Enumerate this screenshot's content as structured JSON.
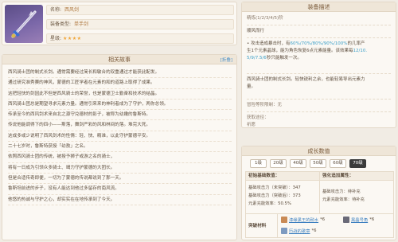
{
  "info": {
    "name_label": "名称:",
    "name_value": "西风剑",
    "type_label": "装备类型:",
    "type_value": "单手剑",
    "stars_label": "星级:",
    "stars": "★★★★"
  },
  "story": {
    "title": "相关故事",
    "fold_link": "[折叠]",
    "lines": [
      "西风骑士团的制式长剑。通常需要经过简长和敏合的双重通过才能获此配发。",
      "通过研究准秀赛的神风，蒙德的工匠学者在元素的和的道路上取得了成果。",
      "这把轻快的剑因此不但是西风骑士的荣誉，也是蒙德卫士勤奋和技术的结晶。",
      "西风骑士团总是期望寻求元素力量。通常引来来的神利者成为了守护，两你总领。",
      "传承至今的西风剑术来自北之源守兑德材的影子，被称为幼嫩的鲁斯特。",
      "传说他能调得下的四小——斯落，舞剑严彩的风和林间的落。堆完大死。",
      "这成多或少说明了西风剑术的性情：轻、快、精准，以此守护蒙德平安。",
      "二十七岁时，鲁斯特获授「幼敖」之名。",
      "依照西风骑士团的传统，被授予狮子或游之名的骑士，",
      "将有一日成为引领众多骑士、竭力守护蒙德的大团长。",
      "但是合适传奇即便，一切为了蒙德的传说都说到了那一天。",
      "鲁斯坦前进的步子，没有人能达到他过多留存的南风流。",
      "他悠的热诚与守护之心，却实实在在地传承到了今天。"
    ]
  },
  "desc": {
    "title": "装备描述",
    "refine_hint": "精炼(1/2/3/4/5)阶",
    "passive_name": "顺风而行",
    "effect_1": "• 攻击造成暴击时，有",
    "effect_1_pct": "60%/70%/80%/90%/100%",
    "effect_1b": "的几率产",
    "effect_2": "生1个元素晶球，能为角色恢复6点元素能量。该效果每",
    "effect_2_cd": "12/10.",
    "effect_3_cd": "5/9/7.5/6",
    "effect_3": "秒只能触发一次。",
    "lore_1": "西风骑士团的制式长剑。轻快锐利之余，也能轻易导出元素力",
    "lore_2": "量。",
    "obtain_limit": "冒险等阶限制：无",
    "obtain_label": "获取途径：",
    "obtain_value": "祈愿"
  },
  "growth": {
    "title": "成长数值",
    "tabs": [
      "1级",
      "20级",
      "40级",
      "50级",
      "60级",
      "70级"
    ],
    "active_tab": "70级",
    "initial_label": "初始基础数值：",
    "boost_label": "强化追加属性：",
    "atk_unrefined": "基础攻击力（未突破）：347",
    "atk_refined": "基础攻击力（突破后）：373",
    "recharge": "元素充能效率：50.5%",
    "boost_atk": "基础攻击力：待补充",
    "boost_recharge": "元素充能效率：待补充",
    "materials_label": "突破材料",
    "mat1_name": "漆缘黑王的耐水",
    "mat1_count": "*6",
    "mat2_name": "黑晶号角",
    "mat2_count": "*6",
    "mat3_name": "历战的歌章",
    "mat3_count": "*6"
  },
  "colors": {
    "highlight": "#3da0c9",
    "star": "#f0a63a",
    "panel_header": "#efe6d8"
  }
}
